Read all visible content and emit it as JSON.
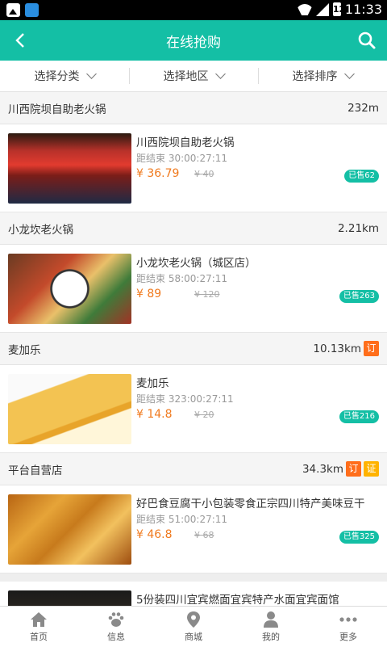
{
  "statusbar": {
    "time": "11:33",
    "battery": "12"
  },
  "header": {
    "title": "在线抢购"
  },
  "filters": [
    {
      "label": "选择分类"
    },
    {
      "label": "选择地区"
    },
    {
      "label": "选择排序"
    }
  ],
  "shops": [
    {
      "name": "川西院坝自助老火锅",
      "distance": "232m",
      "tags": [],
      "deal": {
        "name": "川西院坝自助老火锅",
        "timer": "距结束 30:00:27:11",
        "price": "¥ 36.79",
        "orig": "¥ 40",
        "sold": "已售62"
      }
    },
    {
      "name": "小龙坎老火锅",
      "distance": "2.21km",
      "tags": [],
      "deal": {
        "name": "小龙坎老火锅（城区店）",
        "timer": "距结束 58:00:27:11",
        "price": "¥ 89",
        "orig": "¥ 120",
        "sold": "已售263"
      }
    },
    {
      "name": "麦加乐",
      "distance": "10.13km",
      "tags": [
        "订"
      ],
      "deal": {
        "name": "麦加乐",
        "timer": "距结束 323:00:27:11",
        "price": "¥ 14.8",
        "orig": "¥ 20",
        "sold": "已售216"
      }
    },
    {
      "name": "平台自营店",
      "distance": "34.3km",
      "tags": [
        "订",
        "证"
      ],
      "deal": {
        "name": "好巴食豆腐干小包装零食正宗四川特产美味豆干",
        "timer": "距结束 51:00:27:11",
        "price": "¥ 46.8",
        "orig": "¥ 68",
        "sold": "已售325"
      }
    }
  ],
  "partial_deal": {
    "name": "5份装四川宜宾燃面宜宾特产水面宜宾面馆"
  },
  "tabbar": [
    {
      "label": "首页",
      "icon": "home-icon"
    },
    {
      "label": "信息",
      "icon": "paw-icon"
    },
    {
      "label": "商城",
      "icon": "location-pin-icon"
    },
    {
      "label": "我的",
      "icon": "user-icon"
    },
    {
      "label": "更多",
      "icon": "more-icon"
    }
  ]
}
